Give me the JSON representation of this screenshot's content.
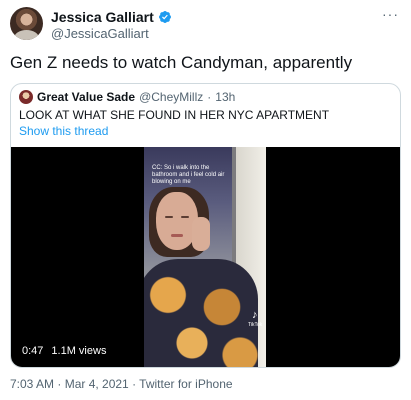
{
  "author": {
    "display_name": "Jessica Galliart",
    "handle": "@JessicaGalliart",
    "verified_icon": "verified-badge-icon",
    "more_icon": "more-options-icon",
    "more_glyph": "···"
  },
  "tweet": {
    "text": "Gen Z needs to watch Candyman, apparently",
    "timestamp": "7:03 AM · Mar 4, 2021 · Twitter for iPhone"
  },
  "quote": {
    "display_name": "Great Value Sade",
    "handle": "@CheyMillz",
    "separator": "·",
    "time": "13h",
    "text": "LOOK AT WHAT SHE FOUND IN HER NYC APARTMENT",
    "show_thread": "Show this thread",
    "video": {
      "caption": "CC: So i walk into the bathroom and i feel cold air blowing on me",
      "watermark": "TikTok",
      "watermark_icon": "♪",
      "duration": "0:47",
      "views": "1.1M views"
    }
  },
  "colors": {
    "accent": "#1d9bf0",
    "secondary_text": "#536471",
    "border": "#cfd9de"
  }
}
